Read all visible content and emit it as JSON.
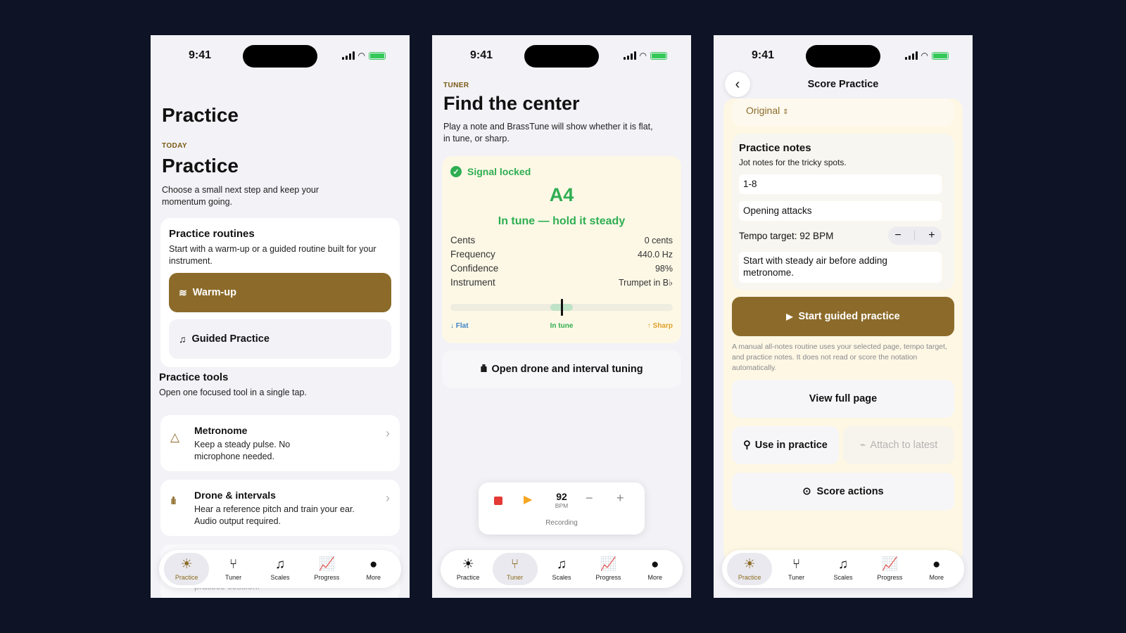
{
  "status": {
    "time": "9:41"
  },
  "tabs": [
    {
      "label": "Practice",
      "icon": "sun-icon"
    },
    {
      "label": "Tuner",
      "icon": "tuning-fork-icon"
    },
    {
      "label": "Scales",
      "icon": "music-list-icon"
    },
    {
      "label": "Progress",
      "icon": "chart-icon"
    },
    {
      "label": "More",
      "icon": "more-icon"
    }
  ],
  "screen1": {
    "nav_title": "Practice",
    "eyebrow": "TODAY",
    "title": "Practice",
    "subtitle": "Choose a small next step and keep your momentum going.",
    "routines": {
      "title": "Practice routines",
      "desc": "Start with a warm-up or a guided routine built for your instrument.",
      "warmup": "Warm-up",
      "guided": "Guided Practice"
    },
    "tools": {
      "title": "Practice tools",
      "desc": "Open one focused tool in a single tap.",
      "items": [
        {
          "title": "Metronome",
          "desc": "Keep a steady pulse. No microphone needed."
        },
        {
          "title": "Drone & intervals",
          "desc": "Hear a reference pitch and train your ear. Audio output required."
        }
      ],
      "partial_desc": "practice session."
    }
  },
  "screen2": {
    "eyebrow": "TUNER",
    "title": "Find the center",
    "subtitle": "Play a note and BrassTune will show whether it is flat, in tune, or sharp.",
    "signal": "Signal locked",
    "note": "A4",
    "status": "In tune — hold it steady",
    "rows": [
      {
        "label": "Cents",
        "value": "0 cents"
      },
      {
        "label": "Frequency",
        "value": "440.0 Hz"
      },
      {
        "label": "Confidence",
        "value": "98%"
      },
      {
        "label": "Instrument",
        "value": "Trumpet in B♭"
      }
    ],
    "meter": {
      "flat": "Flat",
      "in_tune": "In tune",
      "sharp": "Sharp",
      "cents_offset": 0
    },
    "drone_button": "Open drone and interval tuning",
    "recorder": {
      "bpm": "92",
      "bpm_label": "BPM",
      "status": "Recording"
    }
  },
  "screen3": {
    "nav_title": "Score Practice",
    "version": "Original",
    "notes": {
      "title": "Practice notes",
      "desc": "Jot notes for the tricky spots.",
      "measures": "1-8",
      "focus": "Opening attacks",
      "tempo": "Tempo target: 92 BPM",
      "memo": "Start with steady air before adding metronome."
    },
    "start_button": "Start guided practice",
    "disclaimer": "A manual all-notes routine uses your selected page, tempo target, and practice notes. It does not read or score the notation automatically.",
    "view_button": "View full page",
    "use_button": "Use in practice",
    "attach_button": "Attach to latest",
    "actions_button": "Score actions"
  },
  "colors": {
    "accent": "#8c6b2a",
    "success": "#34c759",
    "record": "#e53935",
    "play": "#f5a623"
  }
}
